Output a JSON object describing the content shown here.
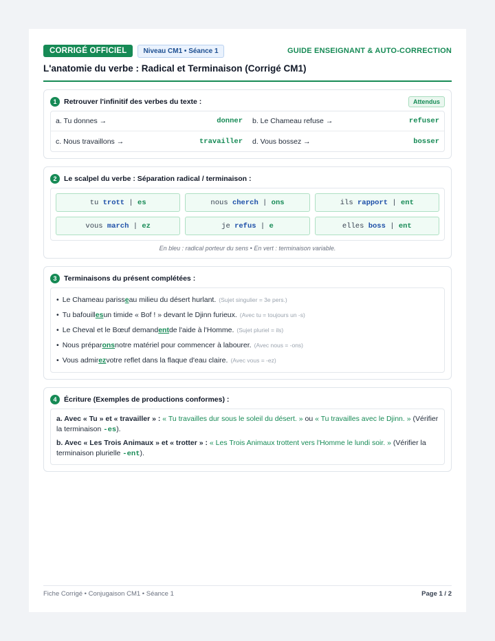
{
  "header": {
    "badge": "CORRIGÉ OFFICIEL",
    "level": "Niveau CM1 • Séance 1",
    "guide": "GUIDE ENSEIGNANT & AUTO-CORRECTION",
    "title": "L'anatomie du verbe : Radical et Terminaison (Corrigé CM1)"
  },
  "s1": {
    "num": "1",
    "title": "Retrouver l'infinitif des verbes du texte :",
    "tag": "Attendus",
    "items": [
      {
        "q": "a. Tu donnes →",
        "a": "donner"
      },
      {
        "q": "b. Le Chameau refuse →",
        "a": "refuser"
      },
      {
        "q": "c. Nous travaillons →",
        "a": "travailler"
      },
      {
        "q": "d. Vous bossez →",
        "a": "bosser"
      }
    ]
  },
  "s2": {
    "num": "2",
    "title": "Le scalpel du verbe : Séparation radical / terminaison :",
    "sep": " | ",
    "items": [
      {
        "p": "tu ",
        "r": "trott",
        "t": "es"
      },
      {
        "p": "nous ",
        "r": "cherch",
        "t": "ons"
      },
      {
        "p": "ils ",
        "r": "rapport",
        "t": "ent"
      },
      {
        "p": "vous ",
        "r": "march",
        "t": "ez"
      },
      {
        "p": "je ",
        "r": "refus",
        "t": "e"
      },
      {
        "p": "elles ",
        "r": "boss",
        "t": "ent"
      }
    ],
    "caption": "En bleu : radical porteur du sens • En vert : terminaison variable."
  },
  "s3": {
    "num": "3",
    "title": "Terminaisons du présent complétées :",
    "bullet": "•",
    "items": [
      {
        "pre": "Le Chameau pariss",
        "end": "e",
        "post": " au milieu du désert hurlant.",
        "note": "(Sujet singulier = 3e pers.)"
      },
      {
        "pre": "Tu bafouill",
        "end": "es",
        "post": " un timide « Bof ! » devant le Djinn furieux.",
        "note": "(Avec tu = toujours un -s)"
      },
      {
        "pre": "Le Cheval et le Bœuf demand",
        "end": "ent",
        "post": " de l'aide à l'Homme.",
        "note": "(Sujet pluriel = ils)"
      },
      {
        "pre": "Nous prépar",
        "end": "ons",
        "post": " notre matériel pour commencer à labourer.",
        "note": "(Avec nous = -ons)"
      },
      {
        "pre": "Vous admir",
        "end": "ez",
        "post": " votre reflet dans la flaque d'eau claire.",
        "note": "(Avec vous = -ez)"
      }
    ]
  },
  "s4": {
    "num": "4",
    "title": "Écriture (Exemples de productions conformes) :",
    "a": {
      "label": "a. Avec « Tu » et « travailler » :",
      "ex1": "« Tu travailles dur sous le soleil du désert. »",
      "or": " ou ",
      "ex2": "« Tu travailles avec le Djinn. »",
      "check": " (Vérifier la terminaison ",
      "code": "-es",
      "close": ")."
    },
    "b": {
      "label": "b. Avec « Les Trois Animaux » et « trotter » :",
      "ex1": "« Les Trois Animaux trottent vers l'Homme le lundi soir. »",
      "check": " (Vérifier la terminaison plurielle ",
      "code": "-ent",
      "close": ")."
    }
  },
  "footer": {
    "left": "Fiche Corrigé • Conjugaison CM1 • Séance 1",
    "right": "Page 1 / 2"
  },
  "colors": {
    "accent": "#168a55",
    "radical": "#1d4fa8"
  }
}
